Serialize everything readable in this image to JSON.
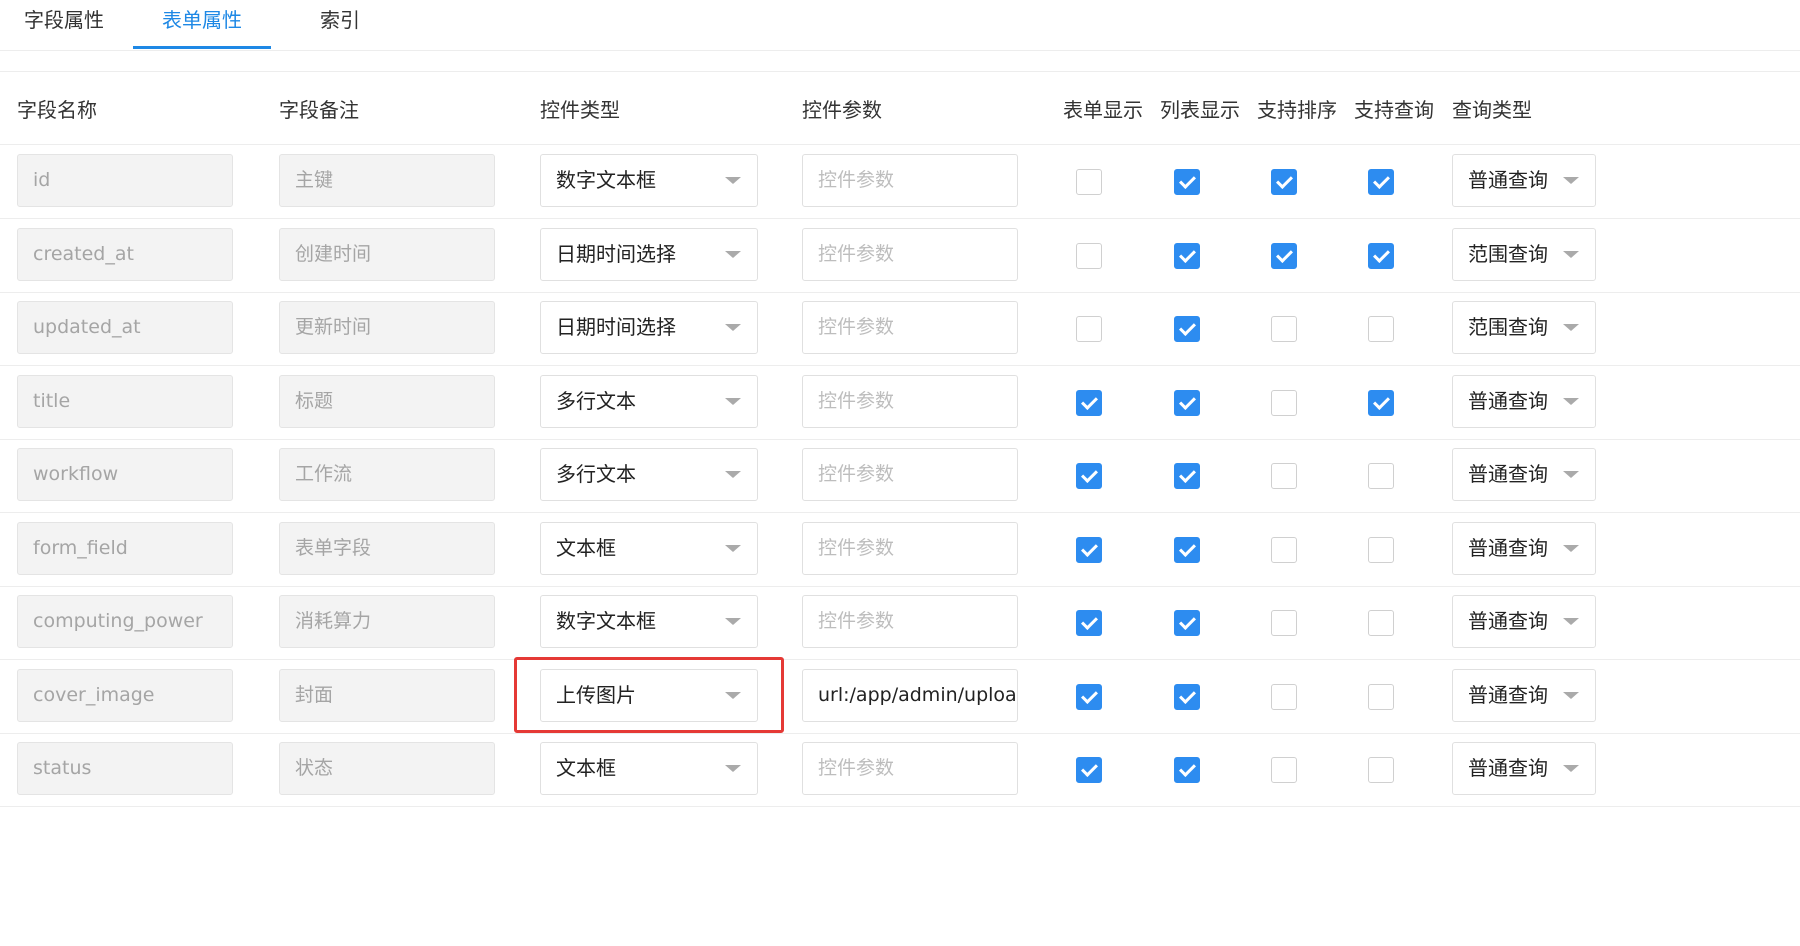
{
  "tabs": [
    {
      "label": "字段属性",
      "active": false
    },
    {
      "label": "表单属性",
      "active": true
    },
    {
      "label": "索引",
      "active": false
    }
  ],
  "columns": {
    "name": "字段名称",
    "comment": "字段备注",
    "control_type": "控件类型",
    "control_params": "控件参数",
    "form_show": "表单显示",
    "list_show": "列表显示",
    "sortable": "支持排序",
    "searchable": "支持查询",
    "query_type": "查询类型"
  },
  "param_placeholder": "控件参数",
  "rows": [
    {
      "name": "id",
      "comment": "主键",
      "control": "数字文本框",
      "param": "",
      "form_show": false,
      "list_show": true,
      "sortable": true,
      "searchable": true,
      "query": "普通查询"
    },
    {
      "name": "created_at",
      "comment": "创建时间",
      "control": "日期时间选择",
      "param": "",
      "form_show": false,
      "list_show": true,
      "sortable": true,
      "searchable": true,
      "query": "范围查询"
    },
    {
      "name": "updated_at",
      "comment": "更新时间",
      "control": "日期时间选择",
      "param": "",
      "form_show": false,
      "list_show": true,
      "sortable": false,
      "searchable": false,
      "query": "范围查询"
    },
    {
      "name": "title",
      "comment": "标题",
      "control": "多行文本",
      "param": "",
      "form_show": true,
      "list_show": true,
      "sortable": false,
      "searchable": true,
      "query": "普通查询"
    },
    {
      "name": "workflow",
      "comment": "工作流",
      "control": "多行文本",
      "param": "",
      "form_show": true,
      "list_show": true,
      "sortable": false,
      "searchable": false,
      "query": "普通查询"
    },
    {
      "name": "form_field",
      "comment": "表单字段",
      "control": "文本框",
      "param": "",
      "form_show": true,
      "list_show": true,
      "sortable": false,
      "searchable": false,
      "query": "普通查询"
    },
    {
      "name": "computing_power",
      "comment": "消耗算力",
      "control": "数字文本框",
      "param": "",
      "form_show": true,
      "list_show": true,
      "sortable": false,
      "searchable": false,
      "query": "普通查询"
    },
    {
      "name": "cover_image",
      "comment": "封面",
      "control": "上传图片",
      "param": "url:/app/admin/upload/",
      "form_show": true,
      "list_show": true,
      "sortable": false,
      "searchable": false,
      "query": "普通查询",
      "highlighted": true
    },
    {
      "name": "status",
      "comment": "状态",
      "control": "文本框",
      "param": "",
      "form_show": true,
      "list_show": true,
      "sortable": false,
      "searchable": false,
      "query": "普通查询"
    }
  ],
  "colors": {
    "accent": "#1e88e5",
    "checkbox": "#2d8cf0",
    "highlight": "#e53935"
  }
}
